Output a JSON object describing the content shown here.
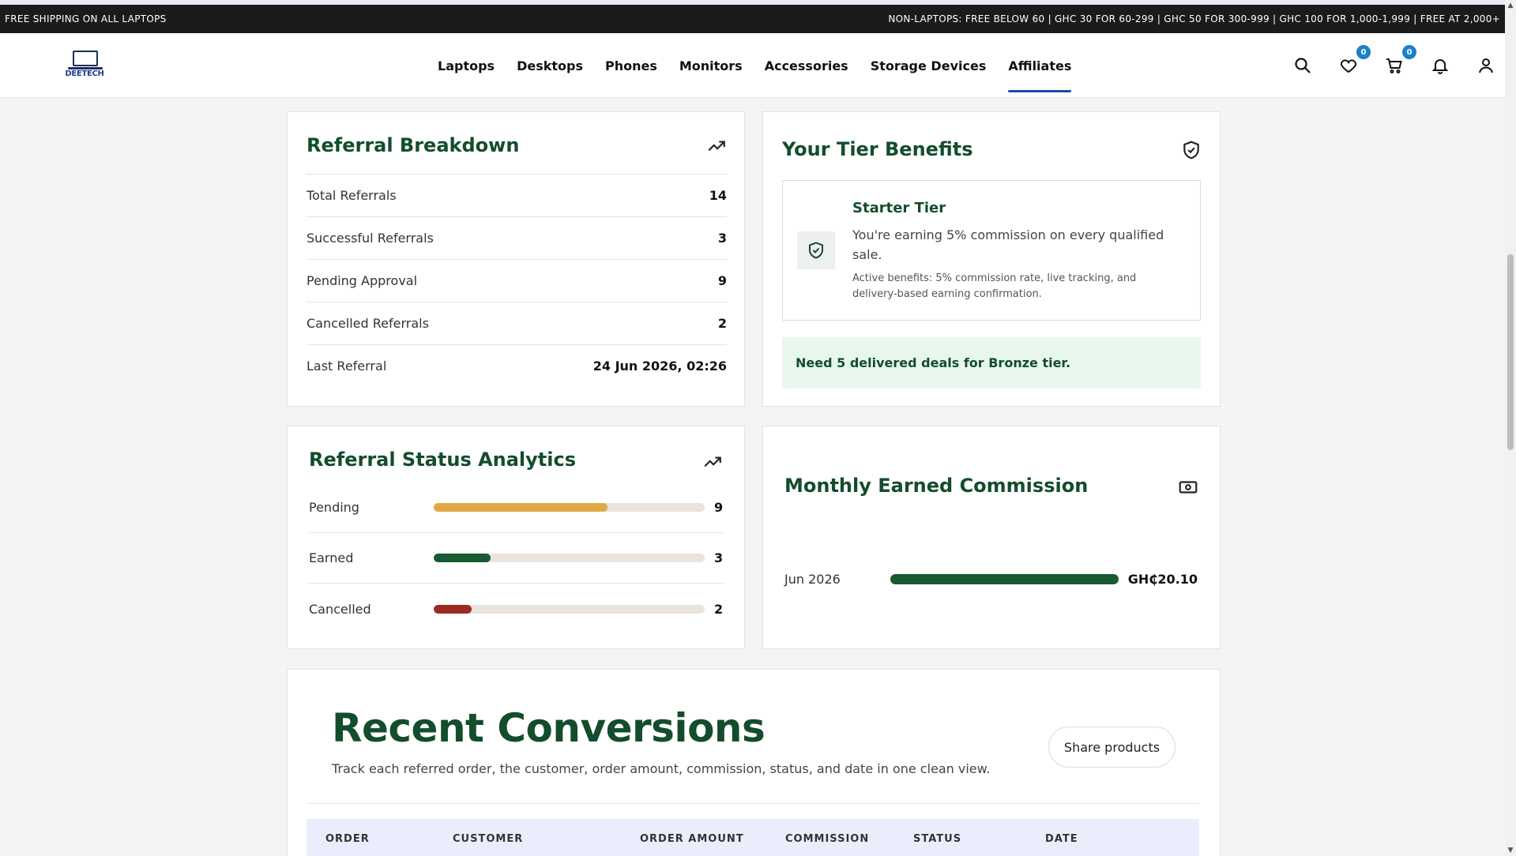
{
  "announcement": {
    "left": "FREE SHIPPING ON ALL LAPTOPS",
    "right": "NON-LAPTOPS: FREE BELOW 60 | GHC 30 FOR 60-299 | GHC 50 FOR 300-999 | GHC 100 FOR 1,000-1,999 | FREE AT 2,000+"
  },
  "header": {
    "logo_text": "DEETECH",
    "nav": [
      "Laptops",
      "Desktops",
      "Phones",
      "Monitors",
      "Accessories",
      "Storage Devices",
      "Affiliates"
    ],
    "active_nav": "Affiliates",
    "wishlist_count": "0",
    "cart_count": "0"
  },
  "referral_breakdown": {
    "title": "Referral Breakdown",
    "rows": [
      {
        "label": "Total Referrals",
        "value": "14"
      },
      {
        "label": "Successful Referrals",
        "value": "3"
      },
      {
        "label": "Pending Approval",
        "value": "9"
      },
      {
        "label": "Cancelled Referrals",
        "value": "2"
      },
      {
        "label": "Last Referral",
        "value": "24 Jun 2026, 02:26"
      }
    ]
  },
  "tier_benefits": {
    "title": "Your Tier Benefits",
    "tier_name": "Starter Tier",
    "description": "You're earning 5% commission on every qualified sale.",
    "note": "Active benefits: 5% commission rate, live tracking, and delivery-based earning confirmation.",
    "need": "Need 5 delivered deals for Bronze tier."
  },
  "status_analytics": {
    "title": "Referral Status Analytics",
    "items": [
      {
        "label": "Pending",
        "value": 9,
        "color": "#e0a945",
        "fraction": 0.64
      },
      {
        "label": "Earned",
        "value": 3,
        "color": "#185a32",
        "fraction": 0.21
      },
      {
        "label": "Cancelled",
        "value": 2,
        "color": "#9c2a1f",
        "fraction": 0.14
      }
    ]
  },
  "monthly_commission": {
    "title": "Monthly Earned Commission",
    "items": [
      {
        "label": "Jun 2026",
        "value": "GH₵20.10",
        "fraction": 1.0,
        "color": "#185a32"
      }
    ]
  },
  "recent_conversions": {
    "title": "Recent Conversions",
    "subtitle": "Track each referred order, the customer, order amount, commission, status, and date in one clean view.",
    "share_label": "Share products",
    "columns": [
      "ORDER",
      "CUSTOMER",
      "ORDER AMOUNT",
      "COMMISSION",
      "STATUS",
      "DATE"
    ]
  }
}
